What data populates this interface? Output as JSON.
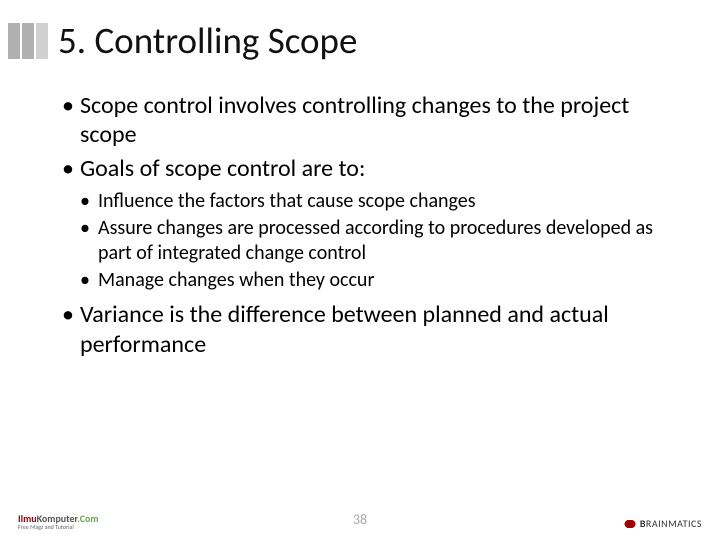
{
  "title": "5. Controlling Scope",
  "bullets": {
    "b1": "Scope control involves controlling changes to the project scope",
    "b2": "Goals of scope control are to:",
    "b2sub": {
      "s1": "Influence the factors that cause scope changes",
      "s2": "Assure changes are processed according to procedures developed as part of integrated change control",
      "s3": "Manage changes when they occur"
    },
    "b3": "Variance is the difference between planned and actual performance"
  },
  "page_number": "38",
  "footer": {
    "left": {
      "part1": "Ilmu",
      "part2": "Komputer",
      "part3": ".Com",
      "tagline": "Free Magz and Tutorial"
    },
    "right": {
      "brand_bold": "B",
      "brand_rest": "RAINMATICS"
    }
  }
}
